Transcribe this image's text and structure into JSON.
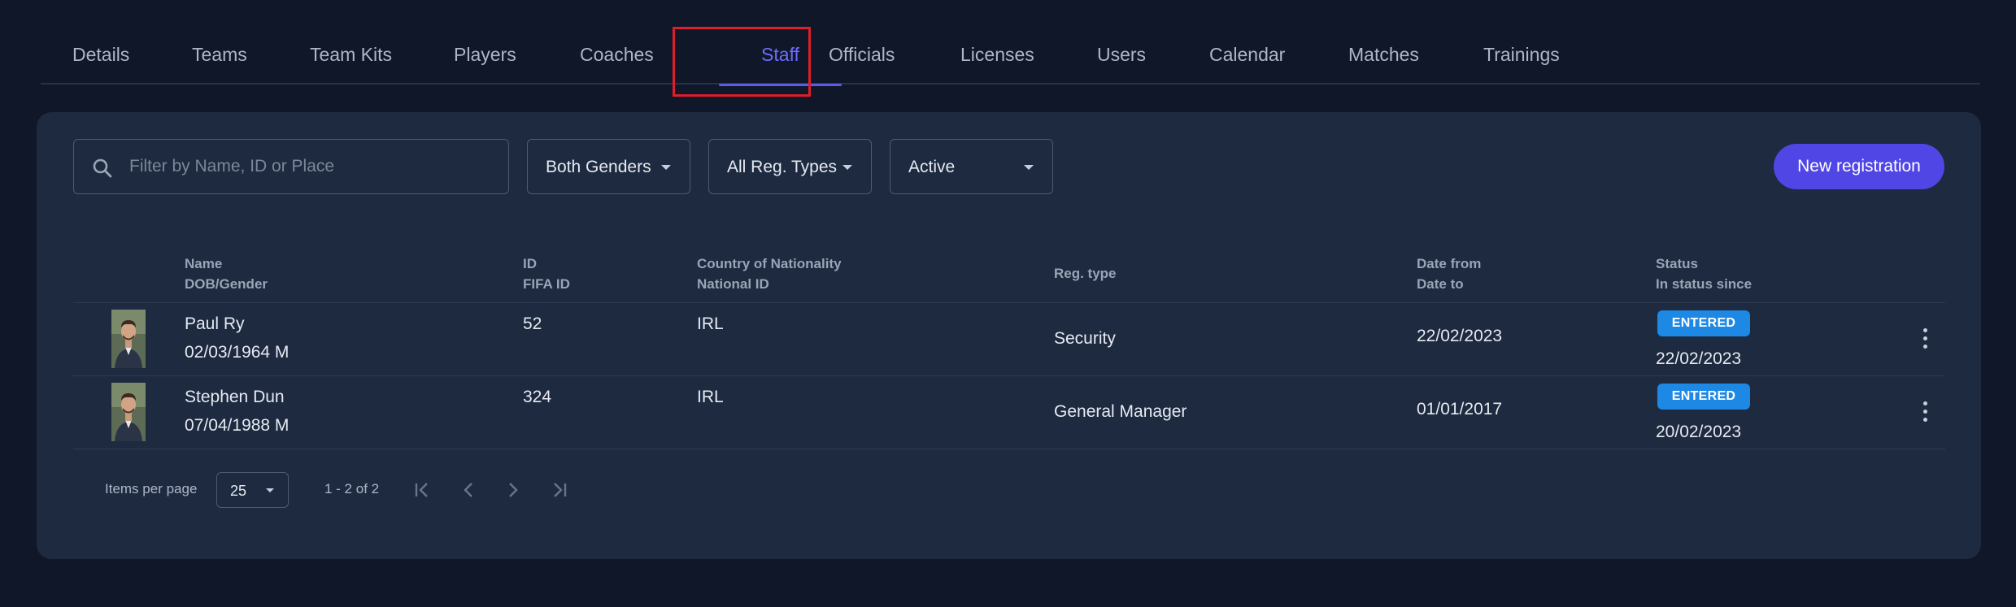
{
  "tabs": [
    {
      "label": "Details"
    },
    {
      "label": "Teams"
    },
    {
      "label": "Team Kits"
    },
    {
      "label": "Players"
    },
    {
      "label": "Coaches"
    },
    {
      "label": "Staff",
      "active": true
    },
    {
      "label": "Officials"
    },
    {
      "label": "Licenses"
    },
    {
      "label": "Users"
    },
    {
      "label": "Calendar"
    },
    {
      "label": "Matches"
    },
    {
      "label": "Trainings"
    }
  ],
  "filters": {
    "search_placeholder": "Filter by Name, ID or Place",
    "gender": "Both Genders",
    "reg_type": "All Reg. Types",
    "status": "Active"
  },
  "new_registration_label": "New registration",
  "table": {
    "headers": {
      "name": "Name",
      "dob_gender": "DOB/Gender",
      "id": "ID",
      "fifa_id": "FIFA ID",
      "country": "Country of Nationality",
      "national_id": "National ID",
      "reg_type": "Reg. type",
      "date_from": "Date from",
      "date_to": "Date to",
      "status": "Status",
      "status_since": "In status since"
    },
    "rows": [
      {
        "name": "Paul Ry",
        "dob_gender": "02/03/1964 M",
        "id": "52",
        "country": "IRL",
        "reg_type": "Security",
        "date_from": "22/02/2023",
        "status": "ENTERED",
        "status_since": "22/02/2023"
      },
      {
        "name": "Stephen Dun",
        "dob_gender": "07/04/1988 M",
        "id": "324",
        "country": "IRL",
        "reg_type": "General Manager",
        "date_from": "01/01/2017",
        "status": "ENTERED",
        "status_since": "20/02/2023"
      }
    ]
  },
  "pagination": {
    "items_per_page_label": "Items per page",
    "items_per_page": "25",
    "range": "1 - 2 of 2"
  },
  "colors": {
    "background": "#0f1729",
    "card": "#1d2a3f",
    "accent": "#4f46e5",
    "active_tab": "#6c6cff",
    "status_badge": "#1e88e5",
    "highlight": "#e01d2a"
  }
}
